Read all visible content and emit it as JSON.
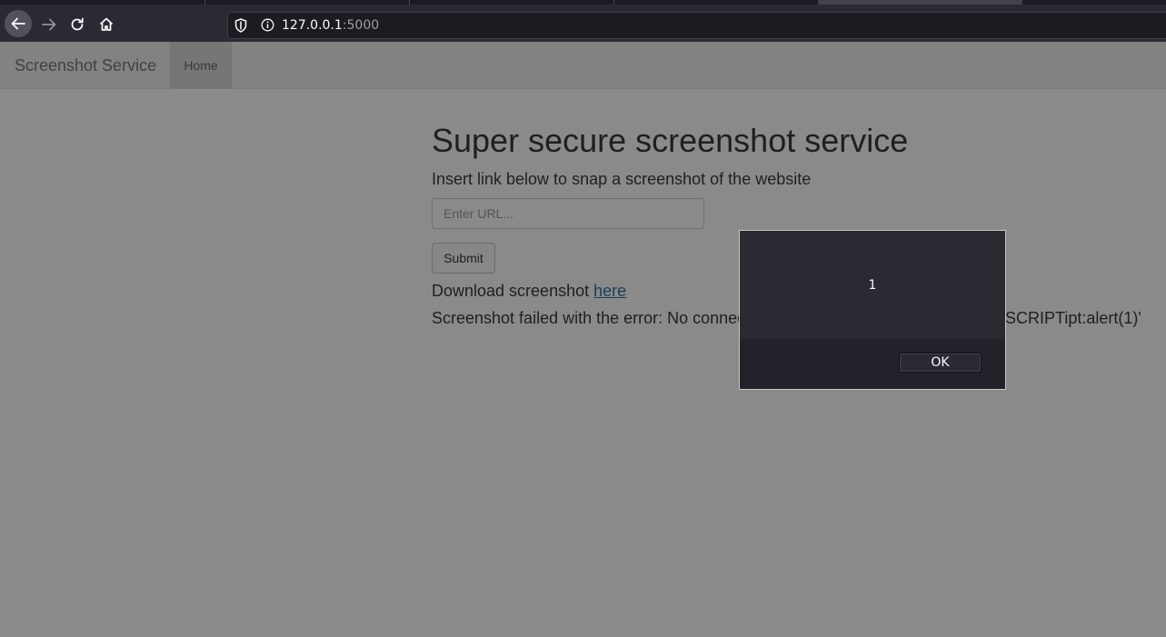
{
  "browser": {
    "url_host": "127.0.0.1",
    "url_port": ":5000"
  },
  "navbar": {
    "brand": "Screenshot Service",
    "home": "Home"
  },
  "main": {
    "heading": "Super secure screenshot service",
    "subtext": "Insert link below to snap a screenshot of the website",
    "url_placeholder": "Enter URL...",
    "submit_label": "Submit",
    "download_prefix": "Download screenshot ",
    "download_link": "here",
    "error_text": "Screenshot failed with the error: No connec",
    "error_tail": "SCRIPTipt:alert(1)'"
  },
  "dialog": {
    "message": "1",
    "ok_label": "OK"
  },
  "colors": {
    "chrome_bg": "#2b2a33",
    "overlay_page": "#8a8a8a",
    "dialog_bg": "#2a2a33"
  }
}
